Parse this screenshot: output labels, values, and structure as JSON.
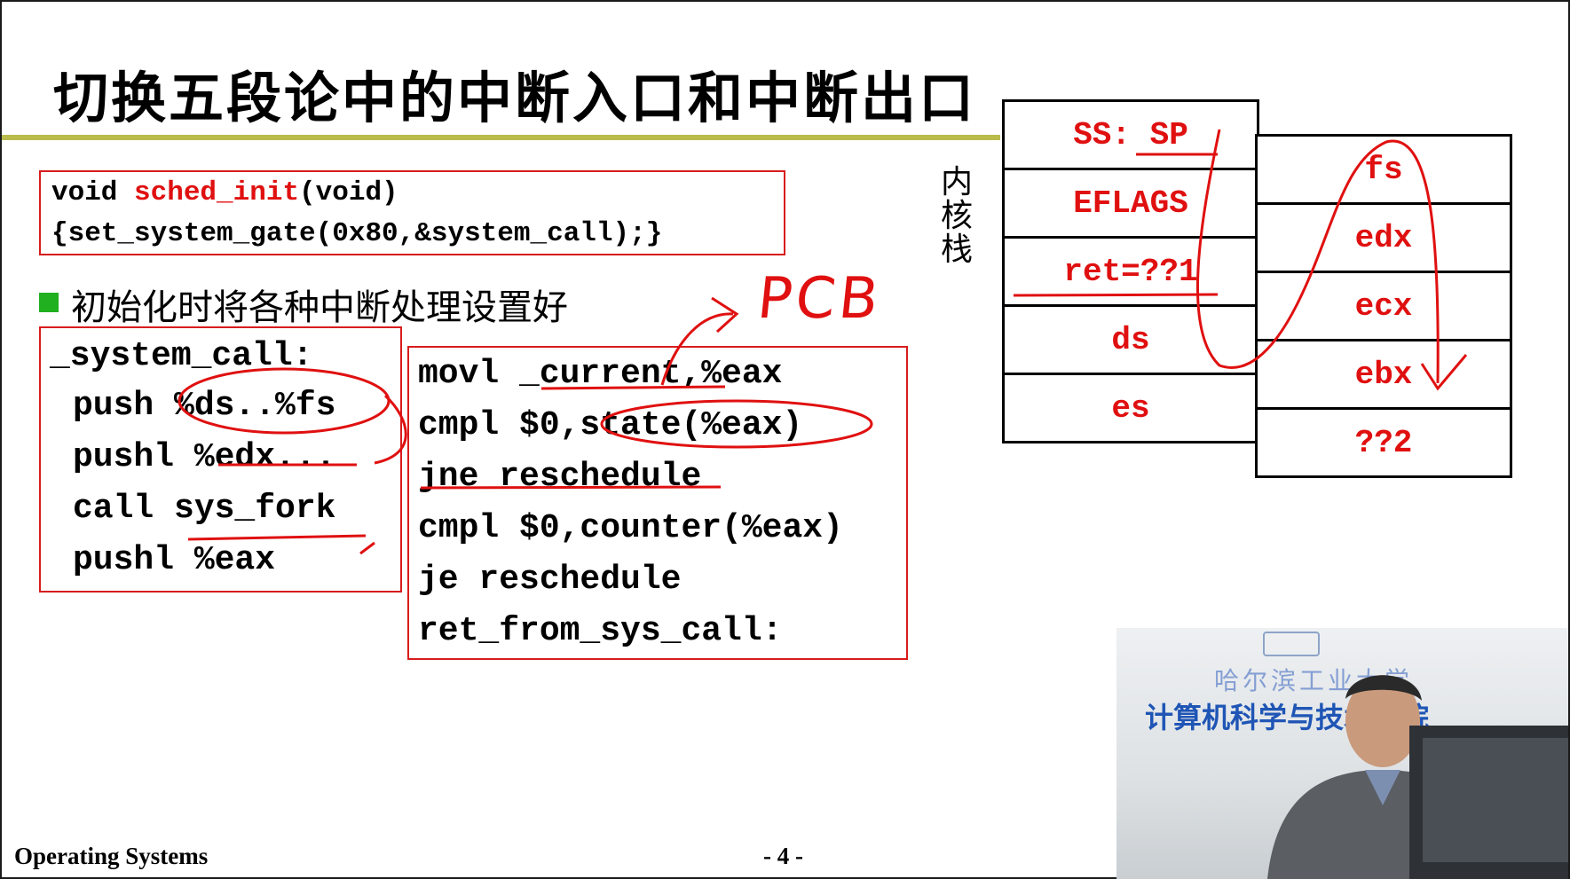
{
  "slide": {
    "title": "切换五段论中的中断入口和中断出口",
    "footer": "Operating Systems",
    "page_number": "- 4 -"
  },
  "init_box": {
    "line1_kw": "void ",
    "line1_fn": "sched_init",
    "line1_rest": "(void)",
    "line2": "{set_system_gate(0x80,&system_call);}"
  },
  "bullet": "初始化时将各种中断处理设置好",
  "left_code": {
    "label": "_system_call:",
    "lines": [
      "push %ds..%fs",
      "pushl %edx...",
      "call sys_fork",
      "pushl %eax"
    ]
  },
  "right_code": {
    "lines": [
      "movl _current,%eax",
      "cmpl $0,state(%eax)",
      "jne reschedule",
      "cmpl $0,counter(%eax)",
      "je reschedule",
      "ret_from_sys_call:"
    ]
  },
  "kernel_stack": {
    "label": "内\n核\n栈",
    "left_cells": [
      "SS: SP",
      "EFLAGS",
      "ret=??1",
      "ds",
      "es"
    ],
    "right_cells": [
      "fs",
      "edx",
      "ecx",
      "ebx",
      "??2"
    ]
  },
  "annotation": "PCB",
  "video": {
    "banner_top": "哈尔滨工业大学",
    "banner_main": "计算机科学与技术学院"
  },
  "colors": {
    "title_rule": "#b9bb4a",
    "code_red": "#e01010",
    "box_border": "#d81c1c",
    "bullet": "#20b020"
  }
}
